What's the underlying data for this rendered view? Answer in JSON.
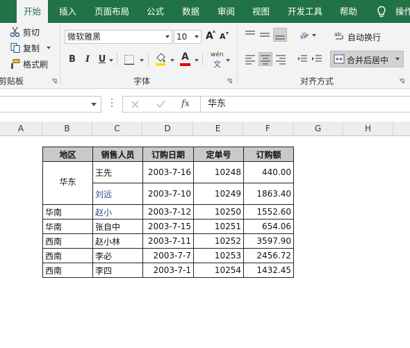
{
  "tabs": [
    {
      "label": "开始",
      "active": true
    },
    {
      "label": "插入"
    },
    {
      "label": "页面布局"
    },
    {
      "label": "公式"
    },
    {
      "label": "数据"
    },
    {
      "label": "审阅"
    },
    {
      "label": "视图"
    },
    {
      "label": "开发工具"
    },
    {
      "label": "帮助"
    },
    {
      "label": "操作"
    }
  ],
  "clipboard": {
    "cut": "剪切",
    "copy": "复制",
    "painter": "格式刷",
    "group_label": "剪贴板"
  },
  "font": {
    "name": "微软雅黑",
    "size": "10",
    "group_label": "字体",
    "bold": "B",
    "italic": "I",
    "underline": "U",
    "grow": "A",
    "shrink": "A",
    "font_color_letter": "A",
    "phonetic_top": "wén",
    "phonetic_bottom": "文",
    "font_color": "#e00000",
    "fill_color": "#ffd700"
  },
  "alignment": {
    "wrap": "自动换行",
    "merge": "合并后居中",
    "group_label": "对齐方式"
  },
  "formula_bar": {
    "value": "华东",
    "fx": "fx"
  },
  "columns": [
    "A",
    "B",
    "C",
    "D",
    "E",
    "F",
    "G",
    "H"
  ],
  "table": {
    "headers": [
      "地区",
      "销售人员",
      "订购日期",
      "定单号",
      "订购额"
    ],
    "merged_region": "华东",
    "rows": [
      {
        "region": "",
        "person": "王先",
        "date": "2003-7-16",
        "order": "10248",
        "amount": "440.00"
      },
      {
        "region": "",
        "person": "刘远",
        "date": "2003-7-10",
        "order": "10249",
        "amount": "1863.40"
      },
      {
        "region": "华南",
        "person": "赵小",
        "date": "2003-7-12",
        "order": "10250",
        "amount": "1552.60"
      },
      {
        "region": "华南",
        "person": "张自中",
        "date": "2003-7-15",
        "order": "10251",
        "amount": "654.06"
      },
      {
        "region": "西南",
        "person": "赵小林",
        "date": "2003-7-11",
        "order": "10252",
        "amount": "3597.90"
      },
      {
        "region": "西南",
        "person": "李必",
        "date": "2003-7-7",
        "order": "10253",
        "amount": "2456.72"
      },
      {
        "region": "西南",
        "person": "李四",
        "date": "2003-7-1",
        "order": "10254",
        "amount": "1432.45"
      }
    ]
  }
}
